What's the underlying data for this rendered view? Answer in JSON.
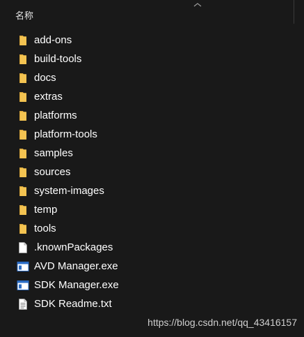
{
  "header": {
    "name_column": "名称"
  },
  "files": [
    {
      "name": "add-ons",
      "type": "folder",
      "icon": "folder-icon"
    },
    {
      "name": "build-tools",
      "type": "folder",
      "icon": "folder-icon"
    },
    {
      "name": "docs",
      "type": "folder",
      "icon": "folder-icon"
    },
    {
      "name": "extras",
      "type": "folder",
      "icon": "folder-icon"
    },
    {
      "name": "platforms",
      "type": "folder",
      "icon": "folder-icon"
    },
    {
      "name": "platform-tools",
      "type": "folder",
      "icon": "folder-icon"
    },
    {
      "name": "samples",
      "type": "folder",
      "icon": "folder-icon"
    },
    {
      "name": "sources",
      "type": "folder",
      "icon": "folder-icon"
    },
    {
      "name": "system-images",
      "type": "folder",
      "icon": "folder-icon"
    },
    {
      "name": "temp",
      "type": "folder",
      "icon": "folder-icon"
    },
    {
      "name": "tools",
      "type": "folder",
      "icon": "folder-icon"
    },
    {
      "name": ".knownPackages",
      "type": "file",
      "icon": "blank-file-icon"
    },
    {
      "name": "AVD Manager.exe",
      "type": "exe",
      "icon": "application-icon"
    },
    {
      "name": "SDK Manager.exe",
      "type": "exe",
      "icon": "application-icon"
    },
    {
      "name": "SDK Readme.txt",
      "type": "text",
      "icon": "text-file-icon"
    }
  ],
  "watermark": "https://blog.csdn.net/qq_43416157",
  "colors": {
    "background": "#191919",
    "folder": "#f3c351",
    "text": "#ffffff"
  }
}
